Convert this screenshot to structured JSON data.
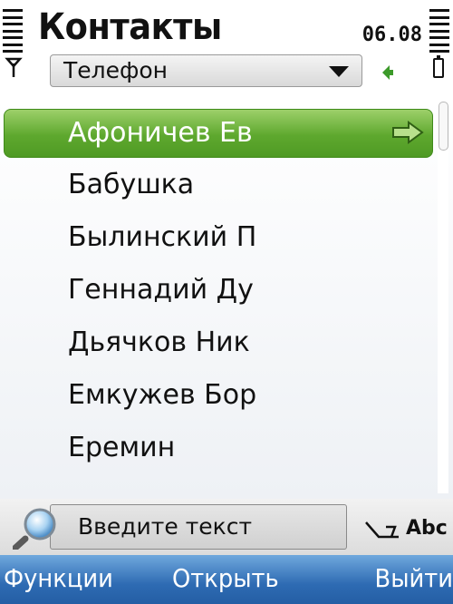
{
  "status": {
    "title": "Контакты",
    "time": "06.08"
  },
  "storage_selector": {
    "selected": "Телефон"
  },
  "contacts": [
    {
      "name": "Афоничев Ев"
    },
    {
      "name": "Бабушка"
    },
    {
      "name": "Былинский П"
    },
    {
      "name": "Геннадий Ду"
    },
    {
      "name": "Дьячков Ник"
    },
    {
      "name": "Емкужев Бор"
    },
    {
      "name": "Еремин"
    }
  ],
  "search": {
    "placeholder": "Введите текст",
    "input_mode": "Abc"
  },
  "softkeys": {
    "left": "Функции",
    "middle": "Открыть",
    "right": "Выйти"
  },
  "colors": {
    "selection_green": "#5ea82e",
    "softkey_blue": "#2e6bb3"
  },
  "icons": [
    "signal-strength-icon",
    "antenna-icon",
    "dropdown-arrow-icon",
    "green-indicator-icon",
    "battery-level-icon",
    "battery-icon",
    "forward-arrow-icon",
    "search-magnifier-icon",
    "input-mode-icon"
  ]
}
